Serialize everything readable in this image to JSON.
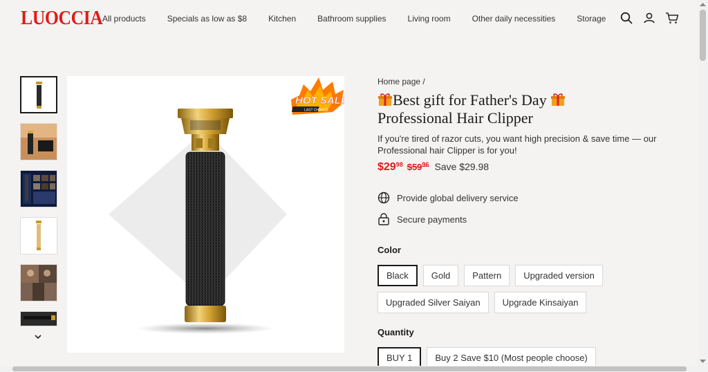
{
  "header": {
    "logo": "LUOCCIA",
    "nav": [
      "All products",
      "Specials as low as $8",
      "Kitchen",
      "Bathroom supplies",
      "Living room",
      "Other daily necessities",
      "Storage"
    ],
    "icons": [
      "search-icon",
      "account-icon",
      "cart-icon"
    ]
  },
  "gallery": {
    "badge": "HOT SALE",
    "badge_sub": "LAST CHANCE",
    "thumbnail_count": 6
  },
  "product": {
    "breadcrumb": "Home page /",
    "title_line1": "Best gift for Father's Day",
    "title_line2": "Professional Hair Clipper",
    "description": "If you're tired of razor cuts,  you want high precision & save time  — our Professional hair Clipper is for you!",
    "price_main": "$29",
    "price_cents": "98",
    "old_main": "$59",
    "old_cents": "96",
    "save": "Save $29.98",
    "features": [
      "Provide global delivery service",
      "Secure payments"
    ],
    "color_label": "Color",
    "colors": [
      "Black",
      "Gold",
      "Pattern",
      "Upgraded version",
      "Upgraded Silver Saiyan",
      "Upgrade Kinsaiyan"
    ],
    "selected_color": "Black",
    "quantity_label": "Quantity",
    "quantities": [
      "BUY 1",
      "Buy 2 Save $10 (Most people choose)"
    ],
    "selected_quantity": "BUY 1"
  },
  "colors": {
    "brand": "#e11a1a",
    "text": "#1a1a1a",
    "background": "#f4f3f1"
  }
}
